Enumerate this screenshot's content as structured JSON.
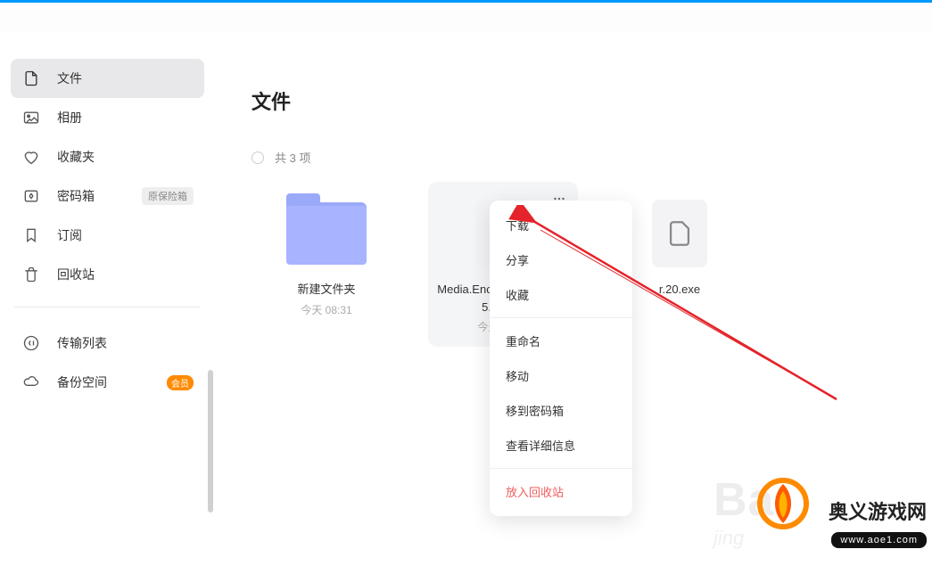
{
  "sidebar": {
    "items": [
      {
        "label": "文件",
        "active": true
      },
      {
        "label": "相册"
      },
      {
        "label": "收藏夹"
      },
      {
        "label": "密码箱",
        "badge_gray": "原保险箱"
      },
      {
        "label": "订阅"
      },
      {
        "label": "回收站"
      }
    ],
    "secondary": [
      {
        "label": "传输列表"
      },
      {
        "label": "备份空间",
        "badge_orange": "会员"
      }
    ]
  },
  "main": {
    "title": "文件",
    "count_text": "共 3 项",
    "items": [
      {
        "name": "新建文件夹",
        "time": "今天 08:31",
        "type": "folder"
      },
      {
        "name": "Media.Encoder.2022.v22.5.0.57(1",
        "time": "今天 08:31",
        "type": "file",
        "selected": true
      },
      {
        "name": "r.20.exe",
        "time": "",
        "type": "file"
      }
    ]
  },
  "context_menu": {
    "items": [
      "下载",
      "分享",
      "收藏"
    ],
    "items2": [
      "重命名",
      "移动",
      "移到密码箱",
      "查看详细信息"
    ],
    "danger": "放入回收站"
  },
  "watermark": {
    "faded": "Ba",
    "faded2": "jing",
    "cn": "奥义游戏网",
    "url": "www.aoe1.com"
  }
}
